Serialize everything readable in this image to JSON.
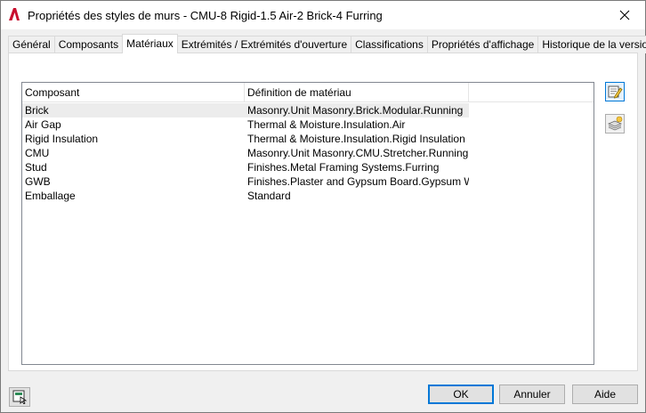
{
  "window": {
    "title": "Propriétés des styles de murs - CMU-8 Rigid-1.5 Air-2 Brick-4 Furring"
  },
  "tabs": [
    {
      "label": "Général",
      "active": false
    },
    {
      "label": "Composants",
      "active": false
    },
    {
      "label": "Matériaux",
      "active": true
    },
    {
      "label": "Extrémités / Extrémités d'ouverture",
      "active": false
    },
    {
      "label": "Classifications",
      "active": false
    },
    {
      "label": "Propriétés d'affichage",
      "active": false
    },
    {
      "label": "Historique de la version",
      "active": false
    }
  ],
  "materials_table": {
    "columns": [
      "Composant",
      "Définition de matériau"
    ],
    "rows": [
      {
        "component": "Brick",
        "definition": "Masonry.Unit Masonry.Brick.Modular.Running",
        "selected": true
      },
      {
        "component": "Air Gap",
        "definition": "Thermal & Moisture.Insulation.Air",
        "selected": false
      },
      {
        "component": "Rigid Insulation",
        "definition": "Thermal & Moisture.Insulation.Rigid Insulation",
        "selected": false
      },
      {
        "component": "CMU",
        "definition": "Masonry.Unit Masonry.CMU.Stretcher.Running",
        "selected": false
      },
      {
        "component": "Stud",
        "definition": "Finishes.Metal Framing Systems.Furring",
        "selected": false
      },
      {
        "component": "GWB",
        "definition": "Finishes.Plaster and Gypsum Board.Gypsum Wallb...",
        "selected": false
      },
      {
        "component": "Emballage",
        "definition": "Standard",
        "selected": false
      }
    ]
  },
  "side_buttons": {
    "edit_icon": "edit-material-icon",
    "add_icon": "add-material-icon"
  },
  "footer": {
    "ok_label": "OK",
    "cancel_label": "Annuler",
    "help_label": "Aide"
  },
  "colors": {
    "accent": "#0078d7",
    "app_icon_red": "#c8102e"
  }
}
